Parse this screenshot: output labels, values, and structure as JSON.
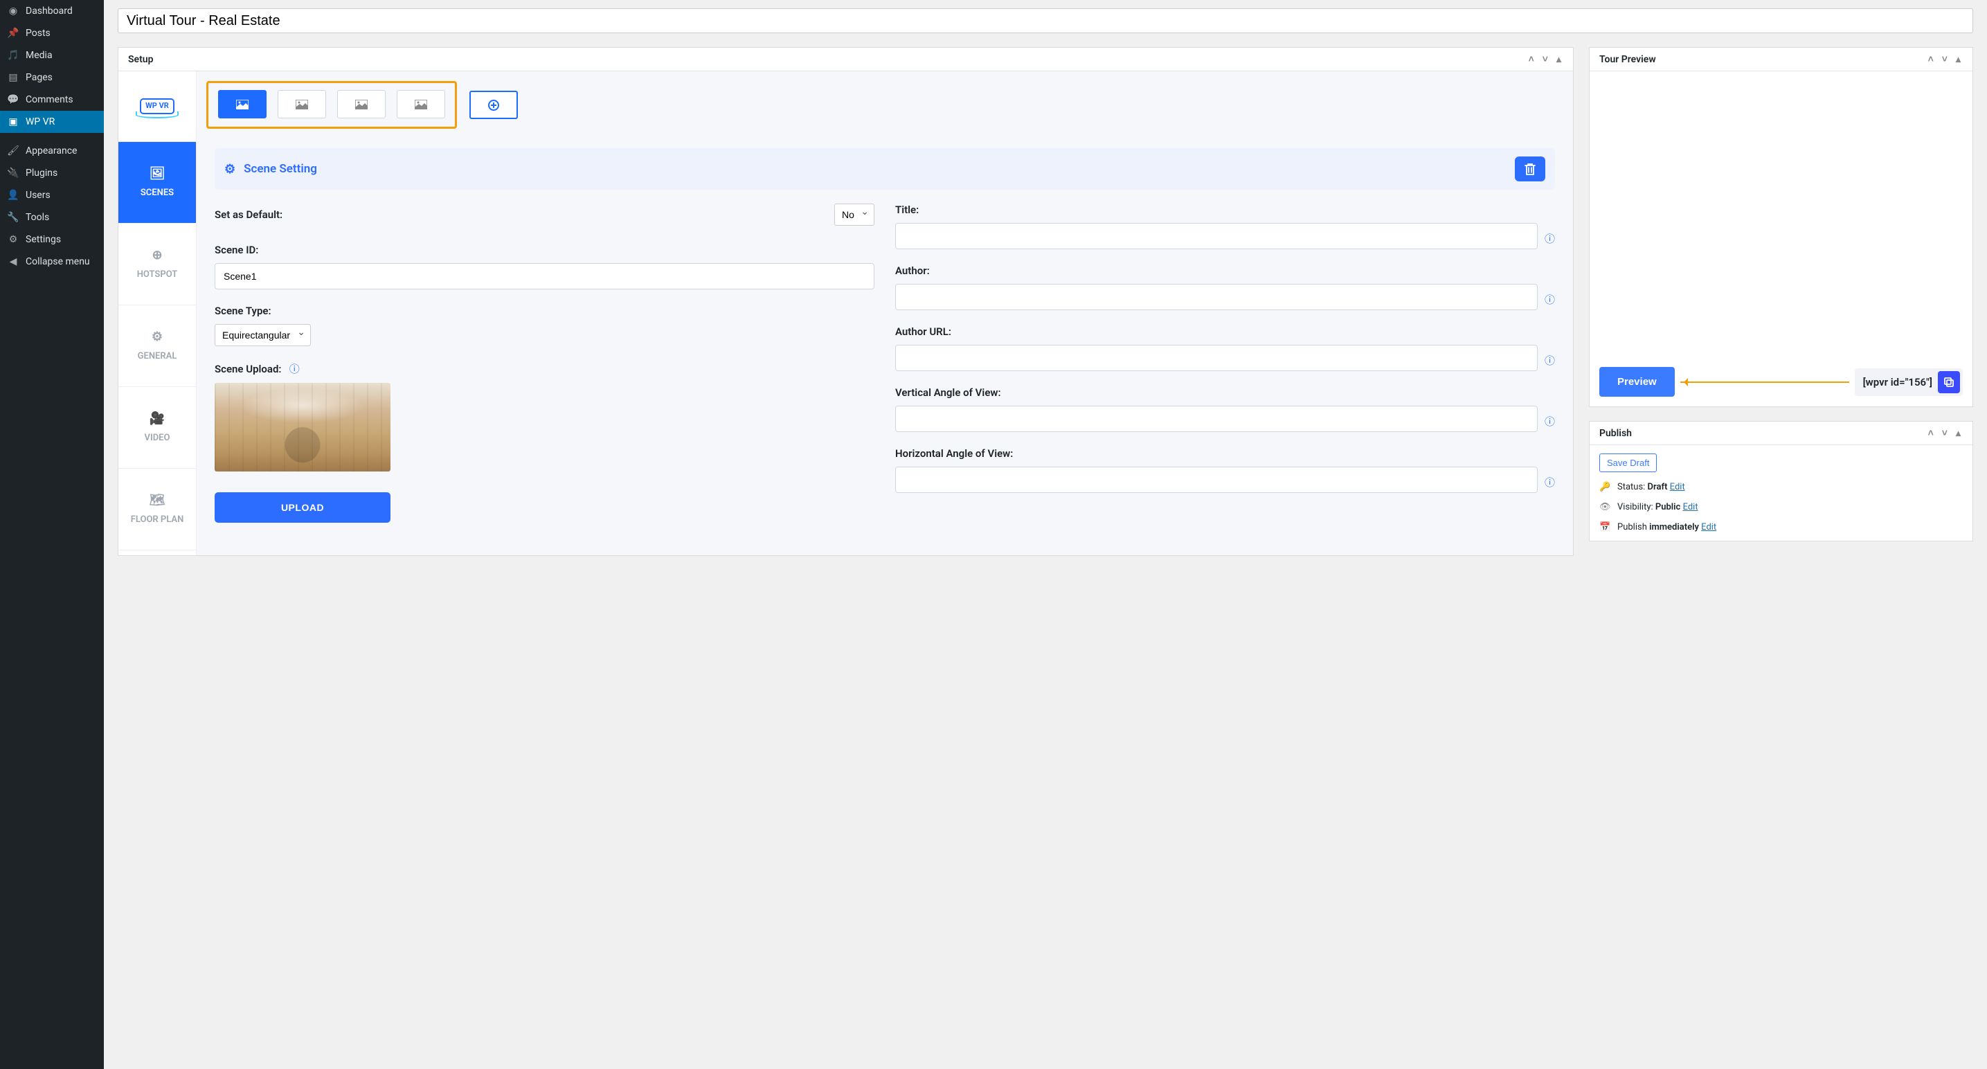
{
  "wpSidebar": {
    "items": [
      {
        "label": "Dashboard"
      },
      {
        "label": "Posts"
      },
      {
        "label": "Media"
      },
      {
        "label": "Pages"
      },
      {
        "label": "Comments"
      },
      {
        "label": "WP VR"
      },
      {
        "label": "Appearance"
      },
      {
        "label": "Plugins"
      },
      {
        "label": "Users"
      },
      {
        "label": "Tools"
      },
      {
        "label": "Settings"
      },
      {
        "label": "Collapse menu"
      }
    ]
  },
  "title": "Virtual Tour - Real Estate",
  "panels": {
    "setup": "Setup",
    "preview": "Tour Preview",
    "publish": "Publish"
  },
  "sideTabs": {
    "logo": "WP VR",
    "scenes": "SCENES",
    "hotspot": "HOTSPOT",
    "general": "GENERAL",
    "video": "VIDEO",
    "floorplan": "FLOOR PLAN"
  },
  "sceneSetting": {
    "header": "Scene Setting",
    "setAsDefault": {
      "label": "Set as Default:",
      "value": "No"
    },
    "sceneId": {
      "label": "Scene ID:",
      "value": "Scene1"
    },
    "sceneType": {
      "label": "Scene Type:",
      "value": "Equirectangular"
    },
    "sceneUpload": {
      "label": "Scene Upload:"
    },
    "uploadBtn": "UPLOAD",
    "title": {
      "label": "Title:"
    },
    "author": {
      "label": "Author:"
    },
    "authorUrl": {
      "label": "Author URL:"
    },
    "vaov": {
      "label": "Vertical Angle of View:"
    },
    "haov": {
      "label": "Horizontal Angle of View:"
    }
  },
  "previewPanel": {
    "btn": "Preview",
    "shortcode": "[wpvr id=\"156\"]"
  },
  "publishPanel": {
    "saveDraft": "Save Draft",
    "statusLabel": "Status: ",
    "statusValue": "Draft",
    "visibilityLabel": "Visibility: ",
    "visibilityValue": "Public",
    "publishLabel": "Publish ",
    "publishValue": "immediately",
    "editLink": "Edit"
  }
}
